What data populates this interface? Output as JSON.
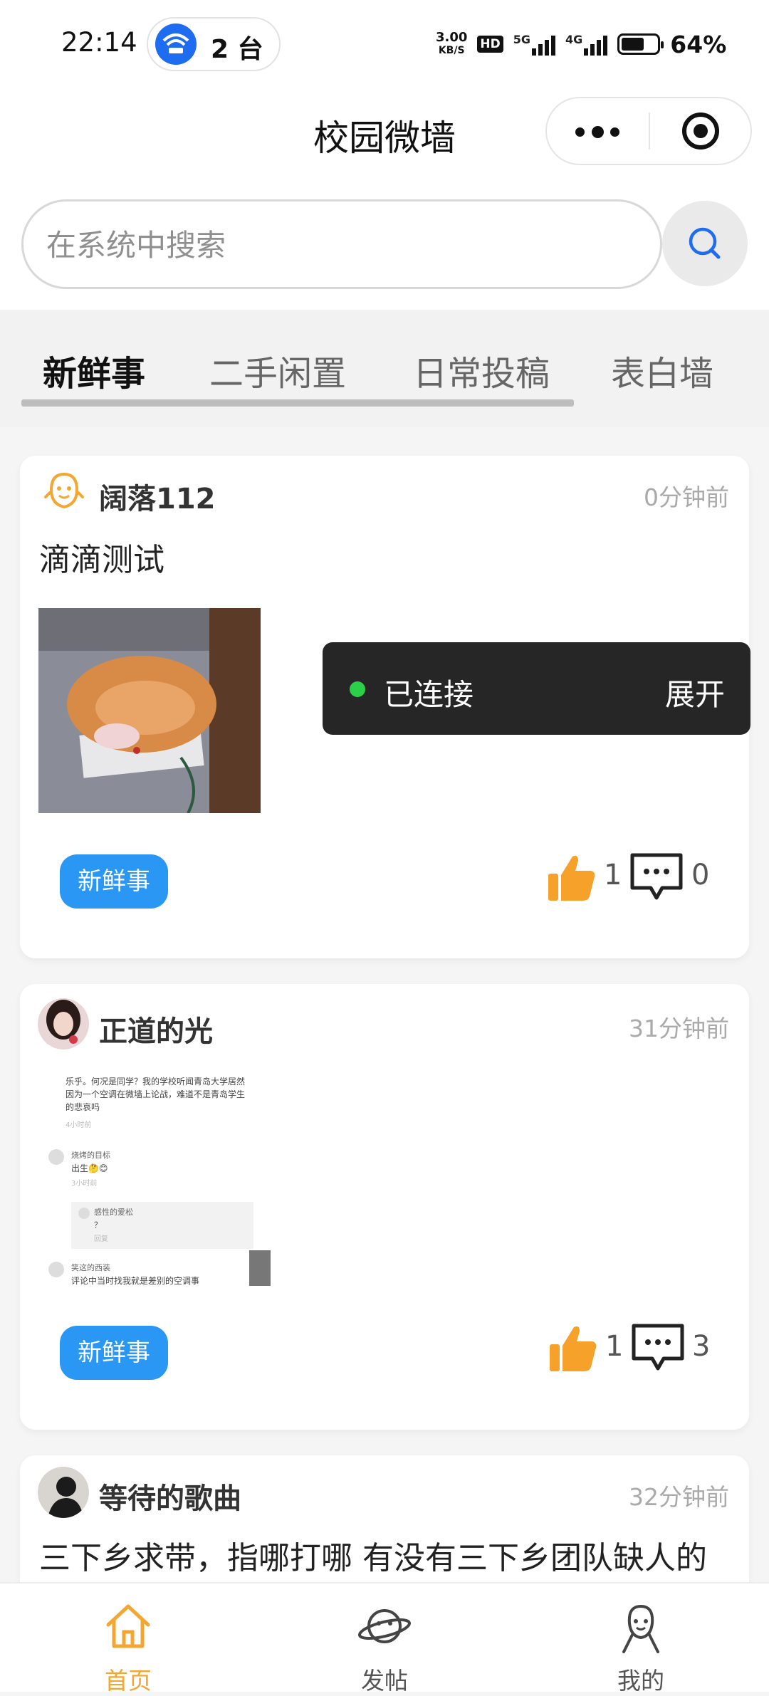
{
  "status_bar": {
    "time": "22:14",
    "hotspot_count": "2 台",
    "net_speed_value": "3.00",
    "net_speed_unit": "KB/S",
    "hd_label": "HD",
    "network_5g": "5G",
    "network_4g": "4G",
    "battery_level_percent": 64,
    "battery": "64%"
  },
  "title_bar": {
    "title": "校园微墙"
  },
  "search": {
    "placeholder": "在系统中搜索"
  },
  "tabs": [
    {
      "label": "新鲜事",
      "active": true
    },
    {
      "label": "二手闲置",
      "active": false
    },
    {
      "label": "日常投稿",
      "active": false
    },
    {
      "label": "表白墙",
      "active": false
    }
  ],
  "posts": [
    {
      "user": "阔落112",
      "time": "0分钟前",
      "text": "滴滴测试",
      "tag": "新鲜事",
      "likes": "1",
      "comments": "0"
    },
    {
      "user": "正道的光",
      "time": "31分钟前",
      "tag": "新鲜事",
      "likes": "1",
      "comments": "3",
      "screenshot": {
        "line1": "乐乎。何况是同学？我的学校听闻青岛大学居然",
        "line2": "因为一个空调在微墙上论战，难道不是青岛学生",
        "line3": "的悲哀吗",
        "time1": "4小时前",
        "c1_name": "烧烤的目标",
        "c1_text": "出生🤔😊",
        "time2": "3小时前",
        "r1_name": "感性的爱松",
        "r1_text": "？",
        "r1_reply": "回复",
        "c2_name": "笑这的西装",
        "c2_text": "评论中当时找我就是差别的空调事"
      }
    },
    {
      "user": "等待的歌曲",
      "time": "32分钟前",
      "text": "三下乡求带，指哪打哪 有没有三下乡团队缺人的"
    }
  ],
  "toast": {
    "status": "已连接",
    "action": "展开"
  },
  "bottom_nav": [
    {
      "label": "首页",
      "icon": "home-icon",
      "active": true
    },
    {
      "label": "发帖",
      "icon": "planet-icon",
      "active": false
    },
    {
      "label": "我的",
      "icon": "user-icon",
      "active": false
    }
  ],
  "colors": {
    "accent_orange": "#f3a631",
    "tag_blue": "#2997f3",
    "like_orange": "#f5a12a",
    "search_blue": "#1e6cf0",
    "toast_bg": "#262626",
    "toast_dot": "#2bd04a"
  }
}
